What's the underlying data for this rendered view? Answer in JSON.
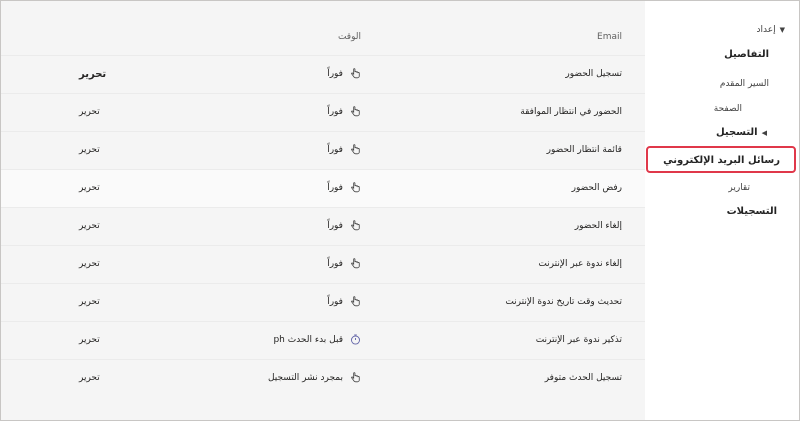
{
  "sidebar": {
    "settings_label": "إعداد",
    "details_label": "التفاصيل",
    "bio_label": "السير المقدم",
    "page_label": "الصفحة",
    "registration_label": "التسجيل",
    "emails_label": "رسائل البريد الإلكتروني",
    "reports_label": "تقارير",
    "recordings_label": "التسجيلات"
  },
  "table": {
    "header_email": "Email",
    "header_time": "الوقت",
    "rows": [
      {
        "name": "تسجيل الحضور",
        "time": "فوراً",
        "edit": "تحرير",
        "icon": "hand-icon"
      },
      {
        "name": "الحضور في انتظار الموافقة",
        "time": "فوراً",
        "edit": "تحرير",
        "icon": "hand-icon"
      },
      {
        "name": "قائمة انتظار الحضور",
        "time": "فوراً",
        "edit": "تحرير",
        "icon": "hand-icon"
      },
      {
        "name": "رفض الحضور",
        "time": "فوراً",
        "edit": "تحرير",
        "icon": "hand-icon"
      },
      {
        "name": "إلغاء الحضور",
        "time": "فوراً",
        "edit": "تحرير",
        "icon": "hand-icon"
      },
      {
        "name": "إلغاء ندوة عبر الإنترنت",
        "time": "فوراً",
        "edit": "تحرير",
        "icon": "hand-icon"
      },
      {
        "name": "تحديث وقت تاريخ ندوة الإنترنت",
        "time": "فوراً",
        "edit": "تحرير",
        "icon": "hand-icon"
      },
      {
        "name": "تذكير ندوة عبر الإنترنت",
        "time": "ph قبل بدء الحدث",
        "edit": "تحرير",
        "icon": "timer-icon"
      },
      {
        "name": "تسجيل الحدث متوفر",
        "time": "بمجرد نشر التسجيل",
        "edit": "تحرير",
        "icon": "hand-icon"
      }
    ]
  },
  "colors": {
    "highlight_border": "#e0384a",
    "timer_icon": "#6264a7"
  }
}
